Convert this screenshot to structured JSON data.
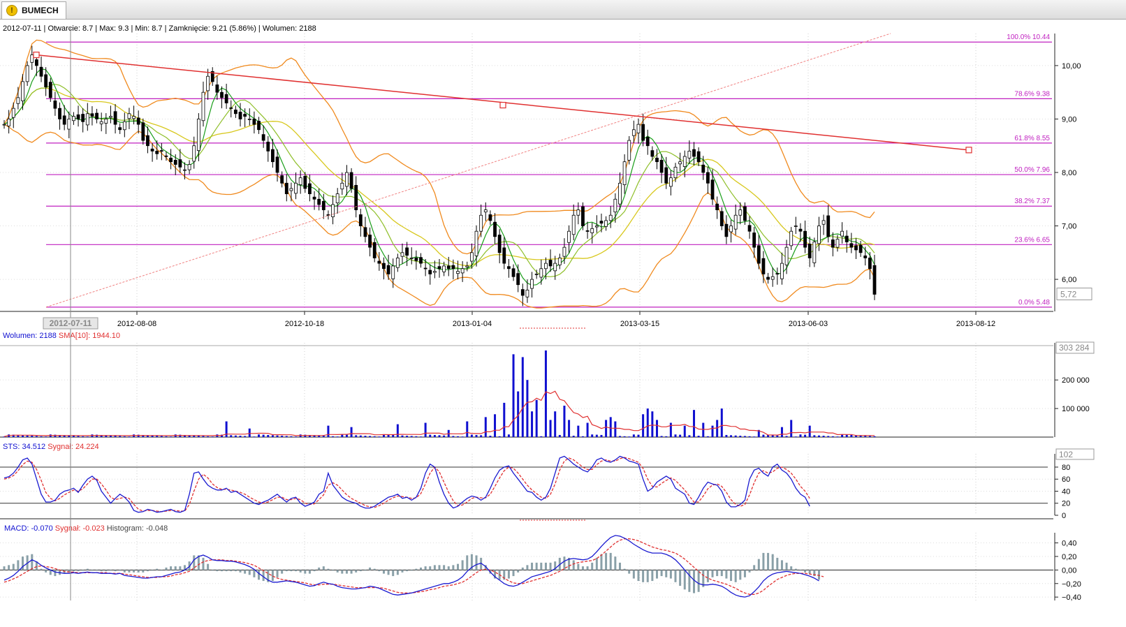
{
  "window": {
    "tab_title": "BUMECH",
    "tab_icon": "warning-icon"
  },
  "info_bar": {
    "date": "2012-07-11",
    "open": "Otwarcie: 8.7",
    "max": "Max: 9.3",
    "min": "Min: 8.7",
    "close": "Zamknięcie: 9.21 (5.86%)",
    "volume": "Wolumen: 2188"
  },
  "chart_data": [
    {
      "type": "candlestick",
      "name": "price",
      "ylim": [
        5.4,
        10.6
      ],
      "y_ticks": [
        "10,00",
        "9,00",
        "8,00",
        "7,00",
        "6,00"
      ],
      "y_tick_values": [
        10.0,
        9.0,
        8.0,
        7.0,
        6.0
      ],
      "x_ticks": [
        "2012-08-08",
        "2012-10-18",
        "2013-01-04",
        "2013-03-15",
        "2013-06-03",
        "2013-08-12"
      ],
      "cursor_date_label": "2012-07-11",
      "last_price_label": "5,72",
      "fibonacci": [
        {
          "label": "100.0% 10.44",
          "value": 10.44
        },
        {
          "label": "78.6% 9.38",
          "value": 9.38
        },
        {
          "label": "61.8% 8.55",
          "value": 8.55
        },
        {
          "label": "50.0% 7.96",
          "value": 7.96
        },
        {
          "label": "38.2% 7.37",
          "value": 7.37
        },
        {
          "label": "23.6% 6.65",
          "value": 6.65
        },
        {
          "label": "0.0% 5.48",
          "value": 5.48
        }
      ],
      "trendline_points": [
        10.2,
        9.26,
        8.42
      ],
      "closes": [
        8.9,
        9.0,
        9.2,
        9.4,
        9.7,
        10.0,
        10.2,
        10.0,
        9.8,
        9.6,
        9.4,
        9.2,
        9.0,
        8.9,
        9.0,
        9.05,
        9.0,
        8.95,
        9.1,
        9.05,
        9.0,
        8.95,
        9.0,
        9.05,
        8.9,
        8.8,
        8.95,
        9.1,
        9.05,
        8.9,
        8.6,
        8.5,
        8.4,
        8.35,
        8.4,
        8.3,
        8.2,
        8.15,
        8.1,
        8.05,
        8.15,
        8.5,
        9.0,
        9.5,
        9.8,
        9.7,
        9.5,
        9.4,
        9.3,
        9.2,
        9.1,
        9.0,
        9.05,
        9.0,
        8.9,
        8.8,
        8.6,
        8.4,
        8.2,
        8.0,
        7.8,
        7.6,
        7.7,
        7.8,
        7.9,
        7.7,
        7.6,
        7.5,
        7.4,
        7.3,
        7.2,
        7.4,
        7.6,
        7.8,
        8.0,
        7.7,
        7.3,
        7.0,
        6.8,
        6.6,
        6.4,
        6.3,
        6.2,
        6.1,
        6.25,
        6.4,
        6.5,
        6.45,
        6.4,
        6.35,
        6.3,
        6.2,
        6.1,
        6.15,
        6.2,
        6.25,
        6.2,
        6.2,
        6.15,
        6.2,
        6.25,
        6.5,
        6.9,
        7.2,
        7.3,
        7.1,
        6.8,
        6.5,
        6.3,
        6.2,
        6.05,
        5.9,
        5.7,
        5.8,
        6.0,
        6.1,
        6.2,
        6.3,
        6.25,
        6.3,
        6.4,
        6.6,
        6.9,
        7.2,
        7.3,
        7.0,
        6.9,
        6.95,
        7.0,
        7.05,
        7.1,
        7.2,
        7.5,
        7.8,
        8.2,
        8.6,
        8.8,
        8.9,
        8.6,
        8.5,
        8.3,
        8.2,
        8.0,
        7.8,
        7.9,
        8.1,
        8.2,
        8.3,
        8.4,
        8.3,
        8.2,
        8.0,
        7.8,
        7.5,
        7.3,
        7.0,
        6.8,
        7.0,
        7.2,
        7.3,
        7.1,
        6.9,
        6.6,
        6.3,
        6.1,
        6.0,
        6.05,
        6.1,
        6.3,
        6.6,
        6.9,
        7.0,
        6.9,
        6.6,
        6.4,
        6.7,
        7.0,
        7.1,
        6.8,
        6.6,
        6.75,
        6.9,
        6.7,
        6.6,
        6.55,
        6.5,
        6.4,
        6.2,
        5.72
      ],
      "sma_short_color": "#1a9e1a",
      "sma_long_color": "#d8c81e",
      "bollinger_color": "#f08a1e",
      "fib_color": "#c020c0",
      "trendline_color": "#e03030"
    },
    {
      "type": "bar",
      "name": "volume",
      "legend": [
        "Wolumen: 2188",
        "SMA[10]: 1944.10"
      ],
      "ylim": [
        0,
        330000
      ],
      "y_ticks": [
        "200 000",
        "100 000"
      ],
      "y_tick_values": [
        200000,
        100000
      ],
      "max_label": "303 284",
      "peaks": [
        {
          "index": 48,
          "value": 55000
        },
        {
          "index": 53,
          "value": 30000
        },
        {
          "index": 70,
          "value": 40000
        },
        {
          "index": 75,
          "value": 35000
        },
        {
          "index": 85,
          "value": 45000
        },
        {
          "index": 91,
          "value": 50000
        },
        {
          "index": 96,
          "value": 25000
        },
        {
          "index": 100,
          "value": 55000
        },
        {
          "index": 104,
          "value": 70000
        },
        {
          "index": 106,
          "value": 80000
        },
        {
          "index": 108,
          "value": 120000
        },
        {
          "index": 110,
          "value": 290000
        },
        {
          "index": 111,
          "value": 160000
        },
        {
          "index": 112,
          "value": 280000
        },
        {
          "index": 113,
          "value": 200000
        },
        {
          "index": 114,
          "value": 90000
        },
        {
          "index": 115,
          "value": 130000
        },
        {
          "index": 117,
          "value": 303284
        },
        {
          "index": 118,
          "value": 60000
        },
        {
          "index": 119,
          "value": 90000
        },
        {
          "index": 121,
          "value": 110000
        },
        {
          "index": 122,
          "value": 60000
        },
        {
          "index": 124,
          "value": 40000
        },
        {
          "index": 126,
          "value": 50000
        },
        {
          "index": 130,
          "value": 60000
        },
        {
          "index": 131,
          "value": 70000
        },
        {
          "index": 132,
          "value": 55000
        },
        {
          "index": 138,
          "value": 80000
        },
        {
          "index": 139,
          "value": 100000
        },
        {
          "index": 140,
          "value": 90000
        },
        {
          "index": 141,
          "value": 60000
        },
        {
          "index": 144,
          "value": 50000
        },
        {
          "index": 147,
          "value": 40000
        },
        {
          "index": 149,
          "value": 95000
        },
        {
          "index": 151,
          "value": 50000
        },
        {
          "index": 153,
          "value": 40000
        },
        {
          "index": 154,
          "value": 60000
        },
        {
          "index": 155,
          "value": 100000
        },
        {
          "index": 163,
          "value": 25000
        },
        {
          "index": 168,
          "value": 35000
        },
        {
          "index": 170,
          "value": 60000
        },
        {
          "index": 174,
          "value": 40000
        },
        {
          "index": 189,
          "value": 30000
        }
      ],
      "bar_color": "#1010d0",
      "sma_color": "#e03030"
    },
    {
      "type": "line",
      "name": "stochastic",
      "legend": [
        "STS: 34.512",
        "Sygnał: 24.224"
      ],
      "ylim": [
        0,
        102
      ],
      "y_ticks": [
        "80",
        "60",
        "40",
        "20",
        "0"
      ],
      "y_tick_values": [
        80,
        60,
        40,
        20,
        0
      ],
      "max_label": "102",
      "levels": [
        80,
        20
      ],
      "sts": [
        62,
        64,
        70,
        80,
        92,
        95,
        85,
        60,
        35,
        22,
        22,
        25,
        35,
        40,
        42,
        45,
        38,
        50,
        60,
        65,
        58,
        40,
        30,
        20,
        28,
        35,
        30,
        22,
        8,
        5,
        6,
        10,
        8,
        5,
        6,
        8,
        10,
        6,
        5,
        8,
        35,
        70,
        72,
        60,
        50,
        45,
        42,
        42,
        45,
        38,
        40,
        35,
        30,
        25,
        20,
        18,
        22,
        25,
        30,
        35,
        28,
        22,
        28,
        30,
        20,
        15,
        18,
        22,
        35,
        40,
        70,
        50,
        40,
        30,
        25,
        22,
        20,
        15,
        12,
        12,
        15,
        20,
        25,
        30,
        32,
        35,
        28,
        30,
        25,
        30,
        45,
        70,
        85,
        80,
        55,
        35,
        20,
        12,
        15,
        22,
        28,
        32,
        30,
        25,
        30,
        45,
        62,
        75,
        80,
        82,
        70,
        60,
        50,
        40,
        38,
        30,
        25,
        30,
        45,
        70,
        95,
        98,
        92,
        85,
        80,
        75,
        72,
        80,
        92,
        95,
        90,
        88,
        92,
        98,
        95,
        90,
        88,
        85,
        60,
        40,
        45,
        55,
        60,
        65,
        60,
        45,
        40,
        35,
        20,
        18,
        30,
        45,
        55,
        52,
        50,
        40,
        22,
        14,
        14,
        18,
        25,
        60,
        75,
        78,
        70,
        65,
        80,
        85,
        75,
        70,
        60,
        45,
        35,
        30,
        15
      ],
      "signal": [
        60,
        62,
        66,
        74,
        84,
        90,
        88,
        76,
        58,
        38,
        28,
        24,
        28,
        34,
        38,
        42,
        40,
        44,
        52,
        60,
        60,
        52,
        42,
        30,
        26,
        28,
        30,
        28,
        18,
        10,
        7,
        8,
        8,
        7,
        6,
        7,
        8,
        8,
        7,
        7,
        18,
        40,
        60,
        68,
        62,
        52,
        46,
        43,
        43,
        42,
        40,
        38,
        35,
        30,
        26,
        22,
        20,
        22,
        26,
        30,
        30,
        26,
        26,
        28,
        26,
        20,
        18,
        19,
        26,
        34,
        50,
        54,
        50,
        42,
        34,
        28,
        24,
        20,
        16,
        14,
        13,
        16,
        20,
        25,
        29,
        32,
        31,
        30,
        28,
        29,
        36,
        52,
        70,
        80,
        72,
        55,
        38,
        24,
        16,
        17,
        22,
        28,
        30,
        29,
        29,
        35,
        48,
        62,
        74,
        80,
        78,
        70,
        60,
        50,
        42,
        36,
        30,
        28,
        35,
        52,
        75,
        90,
        95,
        92,
        86,
        80,
        76,
        76,
        84,
        90,
        92,
        90,
        90,
        94,
        96,
        94,
        91,
        88,
        78,
        60,
        48,
        47,
        53,
        58,
        62,
        58,
        50,
        42,
        32,
        22,
        22,
        32,
        44,
        50,
        52,
        48,
        38,
        26,
        18,
        15,
        18,
        34,
        54,
        70,
        74,
        70,
        72,
        78,
        80,
        76,
        70,
        60,
        48,
        40,
        28
      ],
      "sts_color": "#1a1ad0",
      "signal_color": "#e03030"
    },
    {
      "type": "line",
      "name": "macd",
      "legend": [
        "MACD: -0.070",
        "Sygnał: -0.023",
        "Histogram: -0.048"
      ],
      "ylim": [
        -0.45,
        0.55
      ],
      "y_ticks": [
        "0,40",
        "0,20",
        "0,00",
        "−0,20",
        "−0,40"
      ],
      "y_tick_values": [
        0.4,
        0.2,
        0.0,
        -0.2,
        -0.4
      ],
      "macd": [
        -0.15,
        -0.12,
        -0.08,
        -0.02,
        0.05,
        0.1,
        0.15,
        0.12,
        0.07,
        0.03,
        0,
        -0.03,
        -0.04,
        -0.05,
        -0.05,
        -0.04,
        -0.05,
        -0.04,
        -0.03,
        -0.04,
        -0.04,
        -0.05,
        -0.05,
        -0.05,
        -0.06,
        -0.05,
        -0.08,
        -0.09,
        -0.1,
        -0.11,
        -0.12,
        -0.12,
        -0.11,
        -0.1,
        -0.1,
        -0.08,
        -0.06,
        -0.04,
        -0.03,
        0,
        0.05,
        0.15,
        0.2,
        0.22,
        0.19,
        0.15,
        0.14,
        0.14,
        0.13,
        0.13,
        0.12,
        0.1,
        0.08,
        0.05,
        0.01,
        -0.05,
        -0.1,
        -0.15,
        -0.18,
        -0.18,
        -0.17,
        -0.16,
        -0.17,
        -0.18,
        -0.2,
        -0.22,
        -0.24,
        -0.23,
        -0.2,
        -0.18,
        -0.2,
        -0.21,
        -0.24,
        -0.26,
        -0.27,
        -0.28,
        -0.28,
        -0.27,
        -0.26,
        -0.24,
        -0.25,
        -0.27,
        -0.3,
        -0.33,
        -0.36,
        -0.37,
        -0.36,
        -0.35,
        -0.34,
        -0.32,
        -0.3,
        -0.28,
        -0.26,
        -0.24,
        -0.22,
        -0.2,
        -0.2,
        -0.18,
        -0.15,
        -0.1,
        -0.02,
        0.04,
        0.08,
        0.1,
        0.05,
        -0.03,
        -0.1,
        -0.15,
        -0.2,
        -0.23,
        -0.24,
        -0.22,
        -0.18,
        -0.14,
        -0.1,
        -0.08,
        -0.06,
        -0.04,
        -0.02,
        0.02,
        0.08,
        0.13,
        0.16,
        0.17,
        0.16,
        0.15,
        0.16,
        0.2,
        0.27,
        0.35,
        0.42,
        0.48,
        0.51,
        0.5,
        0.47,
        0.43,
        0.38,
        0.34,
        0.3,
        0.27,
        0.25,
        0.25,
        0.25,
        0.23,
        0.2,
        0.15,
        0.08,
        0,
        -0.08,
        -0.15,
        -0.2,
        -0.22,
        -0.22,
        -0.21,
        -0.22,
        -0.24,
        -0.28,
        -0.33,
        -0.37,
        -0.39,
        -0.4,
        -0.38,
        -0.32,
        -0.25,
        -0.16,
        -0.1,
        -0.06,
        -0.04,
        -0.03,
        -0.02,
        -0.03,
        -0.04,
        -0.05,
        -0.07,
        -0.09,
        -0.12,
        -0.16
      ],
      "signal": [
        -0.18,
        -0.16,
        -0.13,
        -0.1,
        -0.06,
        -0.02,
        0.02,
        0.05,
        0.06,
        0.05,
        0.04,
        0.02,
        0,
        -0.02,
        -0.03,
        -0.03,
        -0.04,
        -0.04,
        -0.04,
        -0.04,
        -0.04,
        -0.04,
        -0.04,
        -0.05,
        -0.05,
        -0.05,
        -0.06,
        -0.07,
        -0.08,
        -0.09,
        -0.1,
        -0.11,
        -0.11,
        -0.11,
        -0.1,
        -0.1,
        -0.09,
        -0.07,
        -0.06,
        -0.04,
        -0.02,
        0.03,
        0.08,
        0.12,
        0.14,
        0.15,
        0.15,
        0.15,
        0.14,
        0.14,
        0.13,
        0.12,
        0.11,
        0.09,
        0.07,
        0.03,
        -0.01,
        -0.05,
        -0.09,
        -0.12,
        -0.14,
        -0.15,
        -0.16,
        -0.17,
        -0.18,
        -0.19,
        -0.21,
        -0.22,
        -0.22,
        -0.21,
        -0.21,
        -0.21,
        -0.22,
        -0.23,
        -0.24,
        -0.25,
        -0.26,
        -0.26,
        -0.26,
        -0.26,
        -0.26,
        -0.26,
        -0.27,
        -0.29,
        -0.31,
        -0.33,
        -0.34,
        -0.34,
        -0.34,
        -0.33,
        -0.32,
        -0.31,
        -0.29,
        -0.28,
        -0.26,
        -0.24,
        -0.23,
        -0.22,
        -0.2,
        -0.18,
        -0.14,
        -0.09,
        -0.04,
        0,
        0.01,
        0,
        -0.03,
        -0.07,
        -0.12,
        -0.16,
        -0.19,
        -0.2,
        -0.2,
        -0.18,
        -0.16,
        -0.14,
        -0.12,
        -0.1,
        -0.08,
        -0.05,
        -0.02,
        0.02,
        0.06,
        0.09,
        0.11,
        0.12,
        0.13,
        0.14,
        0.17,
        0.22,
        0.28,
        0.34,
        0.4,
        0.44,
        0.46,
        0.46,
        0.45,
        0.43,
        0.4,
        0.37,
        0.34,
        0.32,
        0.3,
        0.29,
        0.27,
        0.25,
        0.21,
        0.16,
        0.1,
        0.04,
        -0.02,
        -0.08,
        -0.12,
        -0.15,
        -0.17,
        -0.19,
        -0.21,
        -0.24,
        -0.27,
        -0.31,
        -0.34,
        -0.36,
        -0.36,
        -0.34,
        -0.3,
        -0.24,
        -0.19,
        -0.14,
        -0.11,
        -0.08,
        -0.06,
        -0.05,
        -0.05,
        -0.05,
        -0.06,
        -0.07,
        -0.08,
        -0.1
      ],
      "macd_color": "#1a1ad0",
      "signal_color": "#e03030",
      "histogram_color": "#8aa0a8"
    }
  ]
}
